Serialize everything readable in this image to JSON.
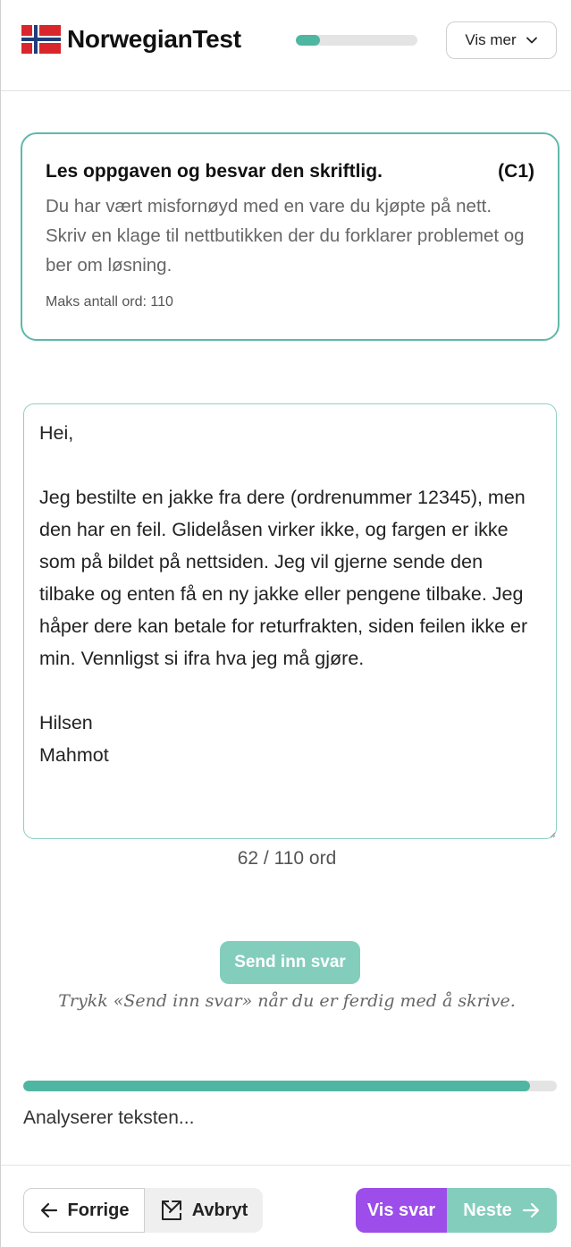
{
  "header": {
    "brand": "NorwegianTest",
    "progress_fraction": 0.2,
    "menu_label": "Vis mer",
    "flag_icon": "norway-flag-icon"
  },
  "task": {
    "title": "Les oppgaven og besvar den skriftlig.",
    "level": "(C1)",
    "body": "Du har vært misfornøyd med en vare du kjøpte på nett. Skriv en klage til nettbutikken der du forklarer problemet og ber om løsning.",
    "max_words": "Maks antall ord: 110"
  },
  "answer": {
    "text": "Hei,\n\nJeg bestilte en jakke fra dere (ordrenummer 12345), men den har en feil. Glidelåsen virker ikke, og fargen er ikke som på bildet på nettsiden. Jeg vil gjerne sende den tilbake og enten få en ny jakke eller pengene tilbake. Jeg håper dere kan betale for returfrakten, siden feilen ikke er min. Vennligst si ifra hva jeg må gjøre.\n\nHilsen\nMahmot",
    "word_count": "62 / 110 ord"
  },
  "submit": {
    "label": "Send inn svar",
    "hint": "Trykk «Send inn svar» når du er ferdig med å skrive."
  },
  "analysis": {
    "progress_fraction": 0.95,
    "status": "Analyserer teksten..."
  },
  "footer": {
    "prev_label": "Forrige",
    "cancel_label": "Avbryt",
    "show_answer_label": "Vis svar",
    "next_label": "Neste"
  },
  "colors": {
    "accent_teal": "#4fb6a1",
    "button_teal": "#83cdbd",
    "purple": "#9d4dea",
    "card_border": "#5fb8a8"
  }
}
